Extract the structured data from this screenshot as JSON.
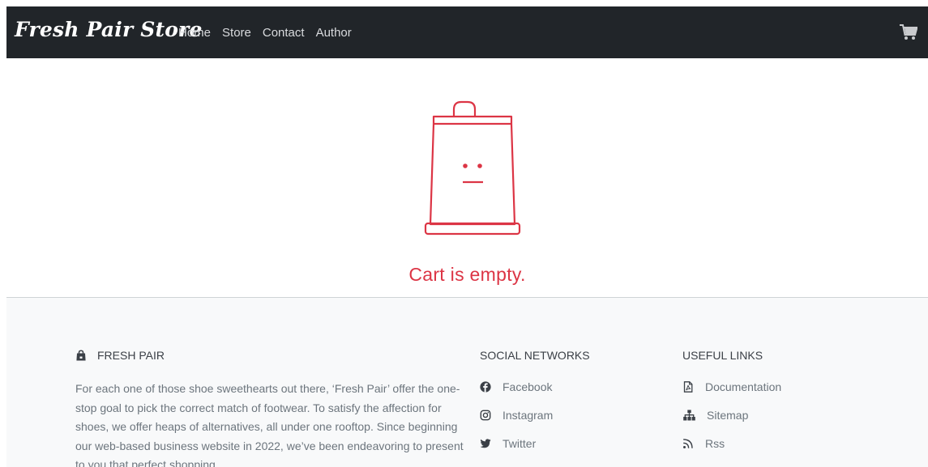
{
  "navbar": {
    "brand": "Fresh Pair Store",
    "links": [
      "Home",
      "Store",
      "Contact",
      "Author"
    ],
    "cart_icon": "shopping-cart-icon"
  },
  "empty_cart": {
    "message": "Cart is empty.",
    "illustration": "sad-shopping-bag-icon",
    "accent_color": "#dc3545"
  },
  "footer": {
    "about": {
      "icon": "shopping-bag-icon",
      "title": "FRESH PAIR",
      "text": "For each one of those shoe sweethearts out there, ‘Fresh Pair’ offer the one-stop goal to pick the correct match of footwear. To satisfy the affection for shoes, we offer heaps of alternatives, all under one rooftop. Since beginning our web-based business website in 2022, we’ve been endeavoring to present to you that perfect shopping"
    },
    "social": {
      "title": "SOCIAL NETWORKS",
      "items": [
        {
          "label": "Facebook",
          "icon": "facebook-icon"
        },
        {
          "label": "Instagram",
          "icon": "instagram-icon"
        },
        {
          "label": "Twitter",
          "icon": "twitter-icon"
        }
      ]
    },
    "useful": {
      "title": "USEFUL LINKS",
      "items": [
        {
          "label": "Documentation",
          "icon": "file-pdf-icon"
        },
        {
          "label": "Sitemap",
          "icon": "sitemap-icon"
        },
        {
          "label": "Rss",
          "icon": "rss-icon"
        }
      ]
    }
  },
  "colors": {
    "navbar_bg": "#212529",
    "footer_bg": "#f8f9fa",
    "muted_text": "#6c757d"
  }
}
